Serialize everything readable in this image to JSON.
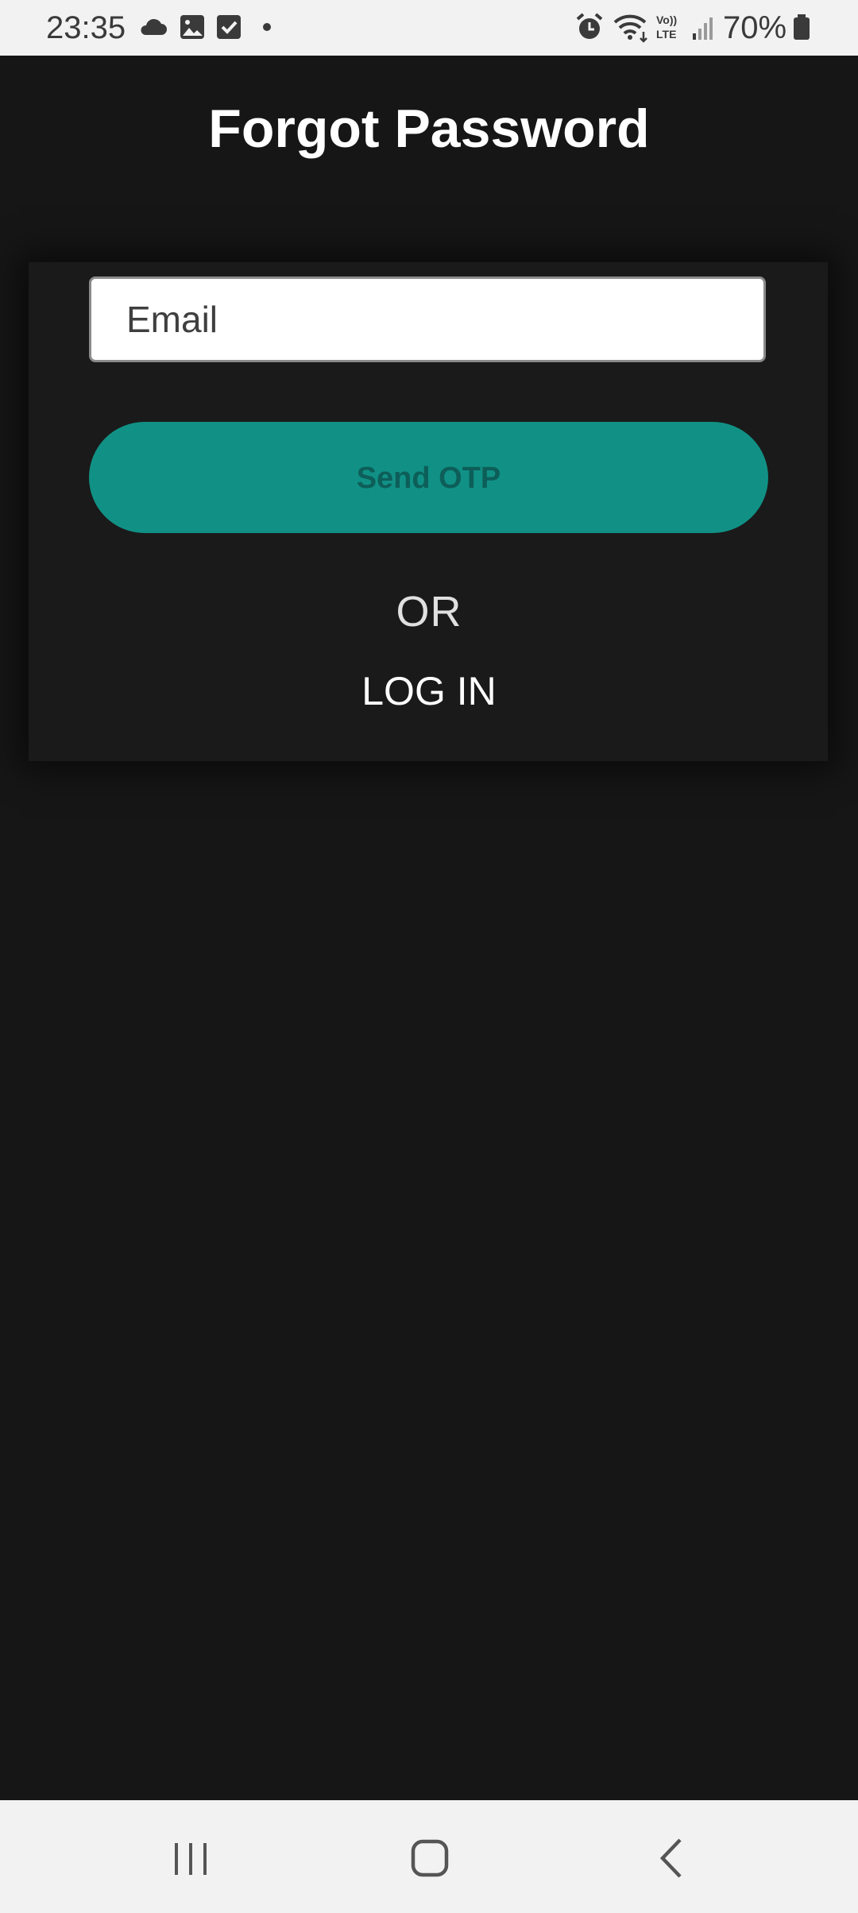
{
  "status_bar": {
    "time": "23:35",
    "battery": "70%",
    "icons": [
      "cloud-icon",
      "gallery-icon",
      "checkbox-icon",
      "dot-icon",
      "alarm-icon",
      "wifi-icon",
      "volte-icon",
      "signal-icon",
      "battery-icon"
    ]
  },
  "header": {
    "title": "Forgot Password"
  },
  "form": {
    "email_placeholder": "Email",
    "email_value": "",
    "send_button_label": "Send OTP",
    "or_label": "OR",
    "login_label": "LOG IN"
  },
  "nav_bar": {
    "buttons": [
      "recent-apps-icon",
      "home-icon",
      "back-icon"
    ]
  },
  "colors": {
    "background": "#161616",
    "accent": "#119185",
    "button_text": "#0d5e59",
    "system_bar": "#f2f2f2"
  }
}
